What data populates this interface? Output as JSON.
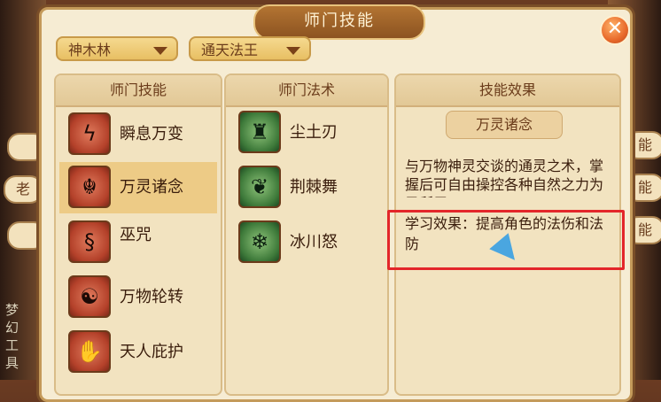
{
  "window": {
    "title": "师门技能"
  },
  "dropdowns": {
    "school": "神木林",
    "rank": "通天法王"
  },
  "columns": {
    "skills": "师门技能",
    "spells": "师门法术",
    "effects": "技能效果"
  },
  "skills": [
    {
      "name": "瞬息万变",
      "icon": "lightning-icon"
    },
    {
      "name": "万灵诸念",
      "icon": "creature-icon",
      "selected": true
    },
    {
      "name": "巫咒",
      "icon": "swirl-icon"
    },
    {
      "name": "万物轮转",
      "icon": "yin-yang-icon"
    },
    {
      "name": "天人庇护",
      "icon": "praying-hands-icon"
    }
  ],
  "spells": [
    {
      "name": "尘土刃",
      "icon": "figure-icon"
    },
    {
      "name": "荆棘舞",
      "icon": "thorn-icon"
    },
    {
      "name": "冰川怒",
      "icon": "glacier-icon"
    }
  ],
  "effect_panel": {
    "skill_title": "万灵诸念",
    "description": "与万物神灵交谈的通灵之术，掌握后可自由操控各种自然之力为己所用。",
    "learn_effect": "学习效果：提高角色的法伤和法防"
  },
  "background": {
    "left_vertical_text": "梦幻工具",
    "side_tabs_left": [
      "",
      "老",
      ""
    ],
    "side_tabs_right": [
      "能",
      "能",
      "能"
    ]
  }
}
